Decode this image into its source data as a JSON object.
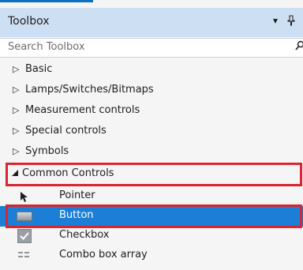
{
  "panel": {
    "title": "Toolbox",
    "dropdown_glyph": "▾",
    "pin_glyph": "⎐"
  },
  "search": {
    "placeholder": "Search Toolbox",
    "icon": "search-icon"
  },
  "categories": [
    {
      "label": "Basic",
      "expanded": false
    },
    {
      "label": "Lamps/Switches/Bitmaps",
      "expanded": false
    },
    {
      "label": "Measurement controls",
      "expanded": false
    },
    {
      "label": "Special controls",
      "expanded": false
    },
    {
      "label": "Symbols",
      "expanded": false
    },
    {
      "label": "Common Controls",
      "expanded": true,
      "highlighted": true
    }
  ],
  "items": [
    {
      "label": "Pointer",
      "icon": "pointer-icon"
    },
    {
      "label": "Button",
      "icon": "button-icon",
      "selected": true,
      "highlighted": true
    },
    {
      "label": "Checkbox",
      "icon": "checkbox-icon"
    },
    {
      "label": "Combo box array",
      "icon": "combo-box-icon"
    }
  ],
  "glyphs": {
    "collapsed": "▷",
    "expanded": "◢"
  },
  "colors": {
    "title_bg": "#cde0f3",
    "selection_bg": "#1c7ed6",
    "highlight_border": "#d9262e"
  }
}
